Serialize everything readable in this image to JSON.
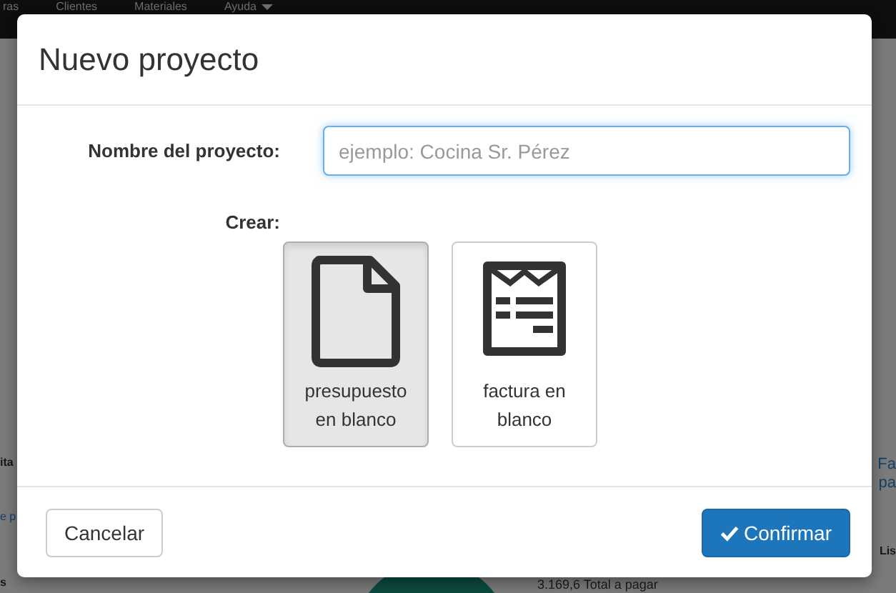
{
  "navbar": {
    "items": [
      {
        "label": "ras",
        "caret": false
      },
      {
        "label": "Clientes",
        "caret": false
      },
      {
        "label": "Materiales",
        "caret": false
      },
      {
        "label": "Ayuda",
        "caret": true
      }
    ]
  },
  "background": {
    "left": [
      {
        "kind": "title",
        "text": "ita"
      },
      {
        "kind": "link",
        "text": "e p"
      },
      {
        "kind": "title",
        "text": "s"
      }
    ],
    "right": [
      {
        "kind": "link",
        "text": "Fa"
      },
      {
        "kind": "link",
        "text": "pa"
      },
      {
        "kind": "title",
        "text": "Lis"
      }
    ],
    "total": "3.169,6 Total a pagar"
  },
  "dialog": {
    "title": "Nuevo proyecto",
    "name_field": {
      "label": "Nombre del proyecto:",
      "placeholder": "ejemplo: Cocina Sr. Pérez",
      "focused": true
    },
    "create_label": "Crear:",
    "options": [
      {
        "kind": "document",
        "label": "presupuesto en blanco",
        "selected": true
      },
      {
        "kind": "invoice",
        "label": "factura en blanco",
        "selected": false
      }
    ],
    "buttons": [
      {
        "kind": "default",
        "label": "Cancelar"
      },
      {
        "kind": "primary",
        "label": "Confirmar"
      }
    ]
  }
}
